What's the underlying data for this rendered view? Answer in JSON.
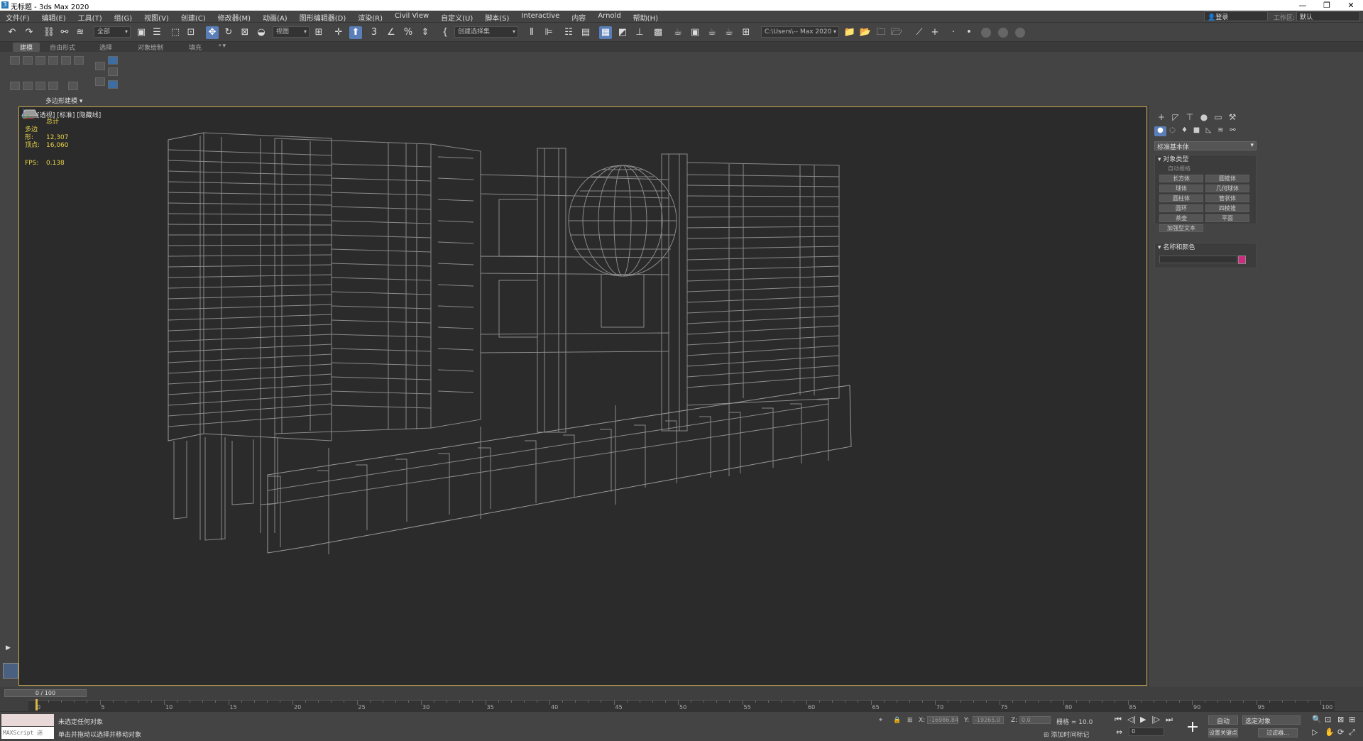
{
  "title": {
    "text": "无标题 - 3ds Max 2020",
    "icon": "3"
  },
  "window": {
    "minimize": "—",
    "restore": "❐",
    "close": "✕"
  },
  "menu": [
    "文件(F)",
    "编辑(E)",
    "工具(T)",
    "组(G)",
    "视图(V)",
    "创建(C)",
    "修改器(M)",
    "动画(A)",
    "图形编辑器(D)",
    "渲染(R)",
    "Civil View",
    "自定义(U)",
    "脚本(S)",
    "Interactive",
    "内容",
    "Arnold",
    "帮助(H)"
  ],
  "login": "登录",
  "workspace": {
    "label": "工作区:",
    "value": "默认"
  },
  "toolbar": {
    "filter": "全部",
    "view": "视图",
    "selection_set": "创建选择集",
    "path": "C:\\Users\\-- Max 2020"
  },
  "ribbon_tabs": [
    "建模",
    "自由形式",
    "选择",
    "对象绘制",
    "填充"
  ],
  "ribbon_group": "多边形建模",
  "viewport": {
    "label": "[+] [透视] [标准] [隐藏线]",
    "stats_total": "总计",
    "polys_label": "多边形:",
    "polys": "12,307",
    "verts_label": "顶点:",
    "verts": "16,060",
    "fps_label": "FPS:",
    "fps": "0.138"
  },
  "command_panel": {
    "category": "标准基本体",
    "object_type": "对象类型",
    "autogrid": "自动栅格",
    "primitives": [
      "长方体",
      "圆锥体",
      "球体",
      "几何球体",
      "圆柱体",
      "管状体",
      "圆环",
      "四棱锥",
      "茶壶",
      "平面",
      "加强型文本"
    ],
    "name_color": "名称和颜色",
    "color": "#d02a80"
  },
  "timeline": {
    "slider": "0 / 100",
    "ticks": [
      "0",
      "5",
      "10",
      "15",
      "20",
      "25",
      "30",
      "35",
      "40",
      "45",
      "50",
      "55",
      "60",
      "65",
      "70",
      "75",
      "80",
      "85",
      "90",
      "95",
      "100"
    ]
  },
  "status": {
    "maxscript": "MAXScript 迷",
    "line1": "未选定任何对象",
    "line2": "单击并拖动以选择并移动对象",
    "x_label": "X:",
    "x": "-16986.84",
    "y_label": "Y:",
    "y": "-19265.0",
    "z_label": "Z:",
    "z": "0.0",
    "grid": "栅格 = 10.0",
    "add_time_tag": "添加时间标记",
    "auto": "自动",
    "selected": "选定对象",
    "set_key": "设置关键点",
    "filters": "过滤器...",
    "frame": "0"
  }
}
